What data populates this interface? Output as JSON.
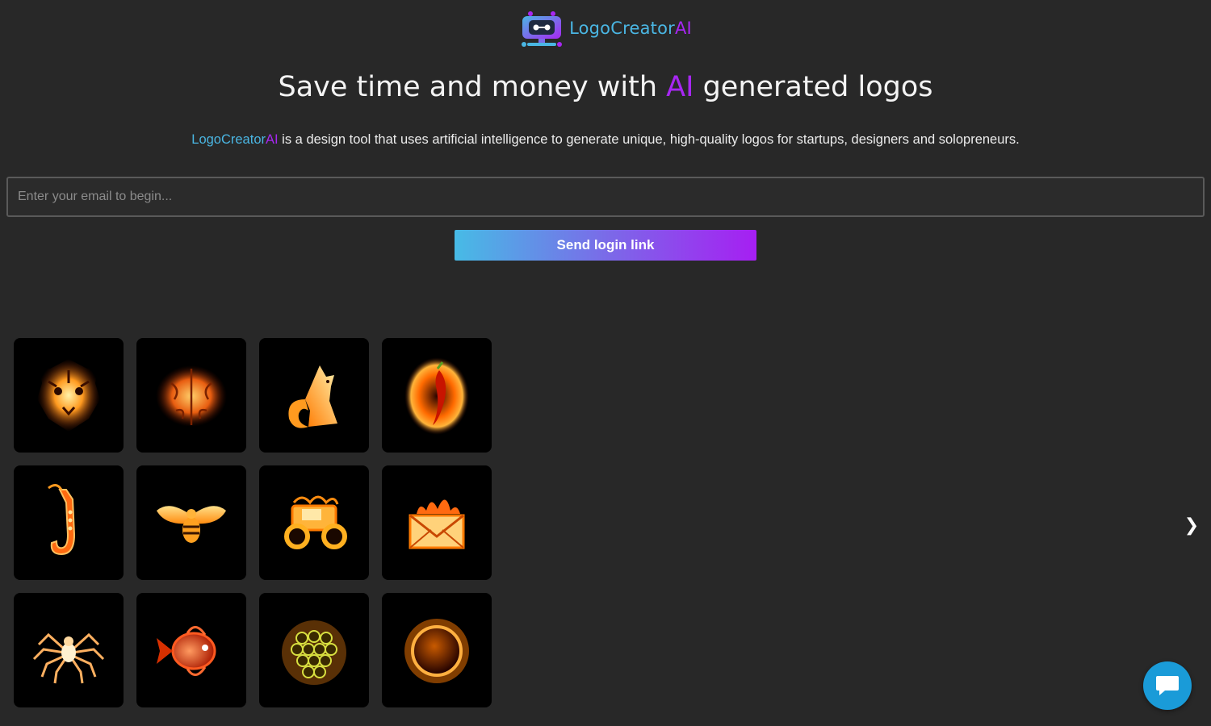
{
  "header": {
    "logo_part1": "LogoCreator",
    "logo_part2": "AI",
    "logo_icon": "robot-logo-icon"
  },
  "hero": {
    "title_before": "Save time and money with ",
    "title_accent": "AI",
    "title_after": " generated logos",
    "subtitle_brand_part1": "LogoCreator",
    "subtitle_brand_part2": "AI",
    "subtitle_rest": " is a design tool that uses artificial intelligence to generate unique, high-quality logos for startups, designers and solopreneurs."
  },
  "form": {
    "email_placeholder": "Enter your email to begin...",
    "email_value": "",
    "send_label": "Send login link"
  },
  "gallery": {
    "prev_label": "❮",
    "next_label": "❯",
    "prev_icon": "chevron-left-icon",
    "next_icon": "chevron-right-icon",
    "tiles": [
      {
        "icon": "fire-tiger-logo"
      },
      {
        "icon": "fire-brain-logo"
      },
      {
        "icon": "fire-fox-logo"
      },
      {
        "icon": "fire-chili-pepper-logo"
      },
      {
        "icon": "fire-saxophone-logo"
      },
      {
        "icon": "fire-bee-logo"
      },
      {
        "icon": "fire-tractor-logo"
      },
      {
        "icon": "fire-envelope-logo"
      },
      {
        "icon": "fire-spider-logo"
      },
      {
        "icon": "fire-fish-logo"
      },
      {
        "icon": "fire-grapes-logo"
      },
      {
        "icon": "fire-sun-logo"
      }
    ]
  },
  "chat": {
    "icon": "chat-bubble-icon"
  },
  "colors": {
    "background": "#282828",
    "brand_blue": "#4ab6e3",
    "brand_purple": "#a727f2",
    "chat_blue": "#1a9bd8"
  }
}
